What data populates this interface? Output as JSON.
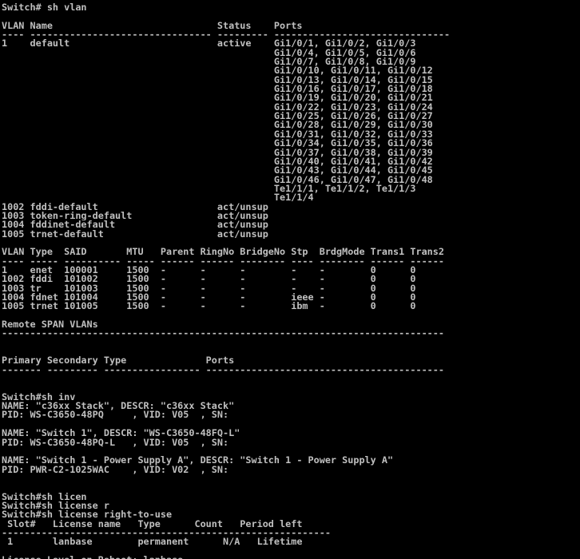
{
  "terminal": {
    "lines": [
      "Switch# sh vlan",
      "",
      "VLAN Name                             Status    Ports",
      "---- -------------------------------- --------- -------------------------------",
      "1    default                          active    Gi1/0/1, Gi1/0/2, Gi1/0/3",
      "                                                Gi1/0/4, Gi1/0/5, Gi1/0/6",
      "                                                Gi1/0/7, Gi1/0/8, Gi1/0/9",
      "                                                Gi1/0/10, Gi1/0/11, Gi1/0/12",
      "                                                Gi1/0/13, Gi1/0/14, Gi1/0/15",
      "                                                Gi1/0/16, Gi1/0/17, Gi1/0/18",
      "                                                Gi1/0/19, Gi1/0/20, Gi1/0/21",
      "                                                Gi1/0/22, Gi1/0/23, Gi1/0/24",
      "                                                Gi1/0/25, Gi1/0/26, Gi1/0/27",
      "                                                Gi1/0/28, Gi1/0/29, Gi1/0/30",
      "                                                Gi1/0/31, Gi1/0/32, Gi1/0/33",
      "                                                Gi1/0/34, Gi1/0/35, Gi1/0/36",
      "                                                Gi1/0/37, Gi1/0/38, Gi1/0/39",
      "                                                Gi1/0/40, Gi1/0/41, Gi1/0/42",
      "                                                Gi1/0/43, Gi1/0/44, Gi1/0/45",
      "                                                Gi1/0/46, Gi1/0/47, Gi1/0/48",
      "                                                Te1/1/1, Te1/1/2, Te1/1/3",
      "                                                Te1/1/4",
      "1002 fddi-default                     act/unsup",
      "1003 token-ring-default               act/unsup",
      "1004 fddinet-default                  act/unsup",
      "1005 trnet-default                    act/unsup",
      "",
      "VLAN Type  SAID       MTU   Parent RingNo BridgeNo Stp  BrdgMode Trans1 Trans2",
      "---- ----- ---------- ----- ------ ------ -------- ---- -------- ------ ------",
      "1    enet  100001     1500  -      -      -        -    -        0      0",
      "1002 fddi  101002     1500  -      -      -        -    -        0      0",
      "1003 tr    101003     1500  -      -      -        -    -        0      0",
      "1004 fdnet 101004     1500  -      -      -        ieee -        0      0",
      "1005 trnet 101005     1500  -      -      -        ibm  -        0      0",
      "",
      "Remote SPAN VLANs",
      "------------------------------------------------------------------------------",
      "",
      "",
      "Primary Secondary Type              Ports",
      "------- --------- ----------------- ------------------------------------------",
      "",
      "",
      "Switch#sh inv",
      "NAME: \"c36xx Stack\", DESCR: \"c36xx Stack\"",
      "PID: WS-C3650-48PQ     , VID: V05  , SN:",
      "",
      "NAME: \"Switch 1\", DESCR: \"WS-C3650-48FQ-L\"",
      "PID: WS-C3650-48PQ-L   , VID: V05  , SN:",
      "",
      "NAME: \"Switch 1 - Power Supply A\", DESCR: \"Switch 1 - Power Supply A\"",
      "PID: PWR-C2-1025WAC    , VID: V02  , SN:",
      "",
      "",
      "Switch#sh licen",
      "Switch#sh license r",
      "Switch#sh license right-to-use",
      " Slot#   License name   Type      Count   Period left",
      "----------------------------------------------------------",
      " 1       lanbase        permanent      N/A   Lifetime",
      "",
      "License Level on Reboot: lanbase"
    ]
  }
}
